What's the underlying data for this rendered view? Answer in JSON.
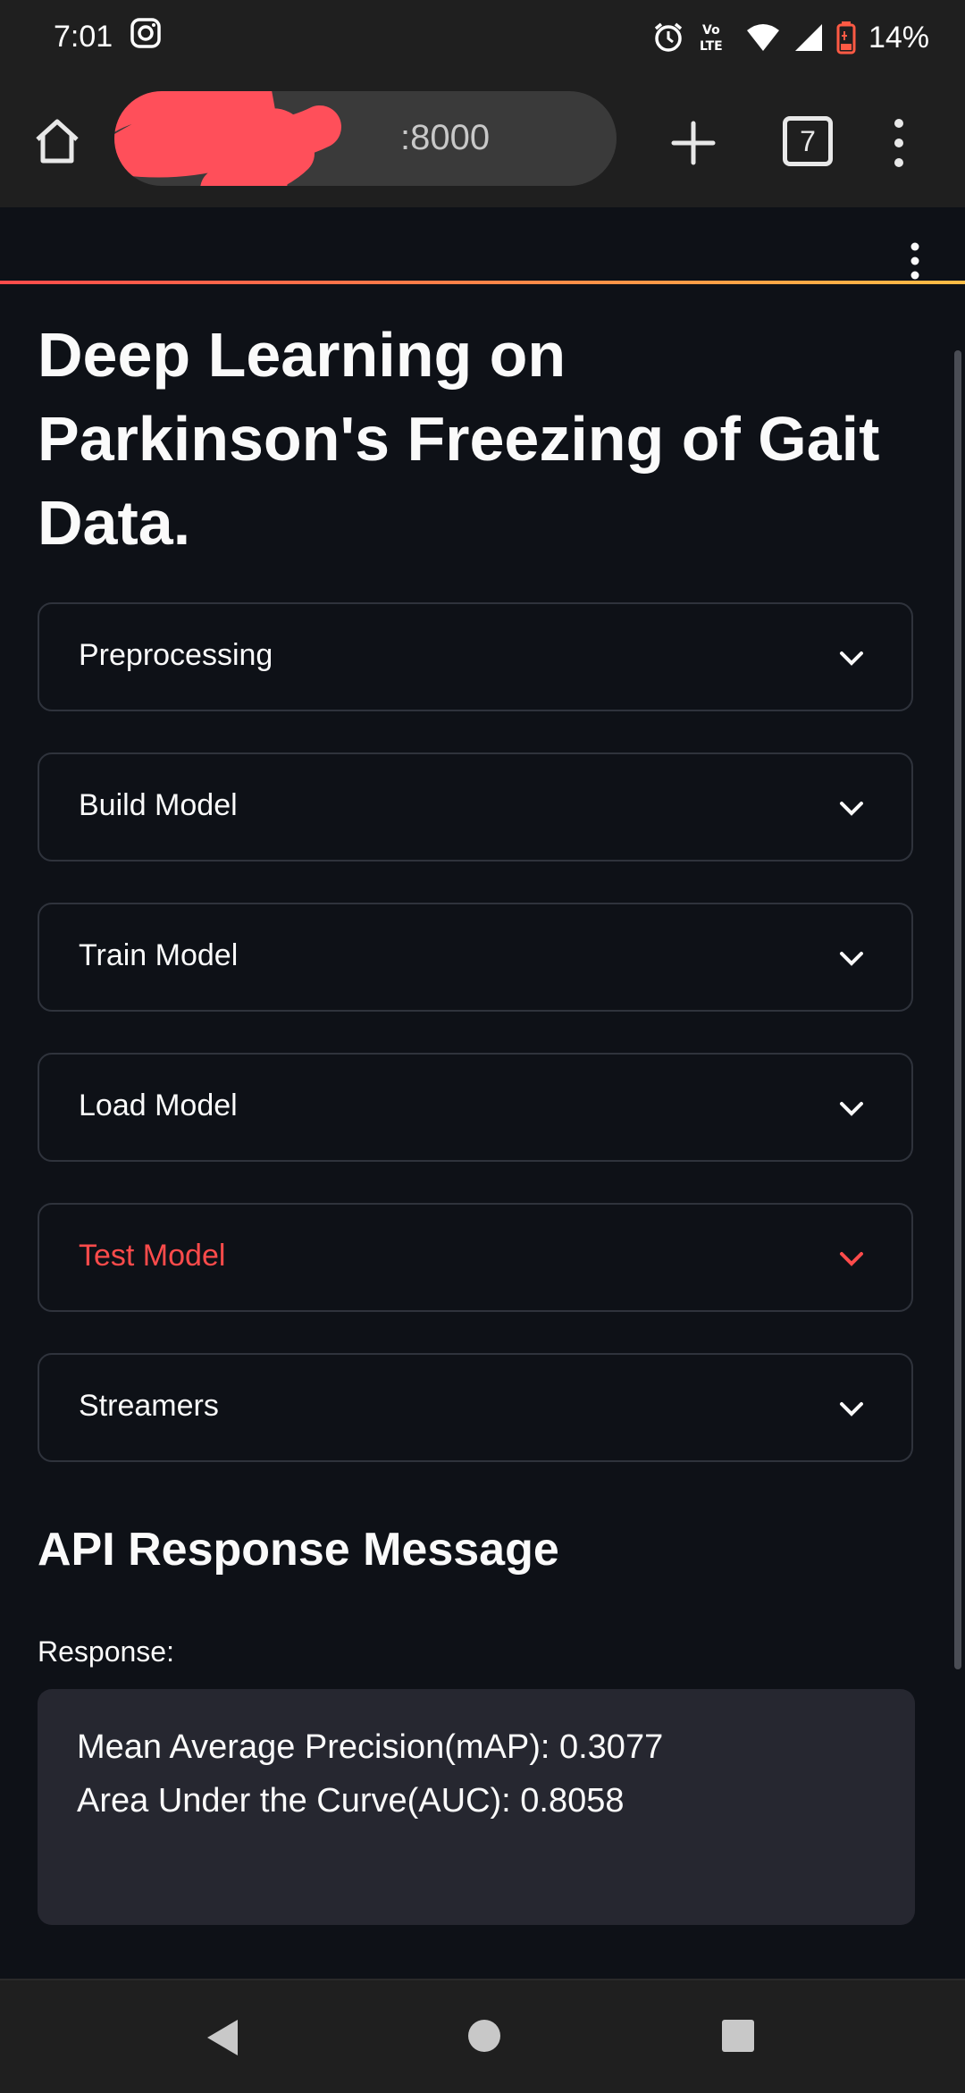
{
  "status_bar": {
    "time": "7:01",
    "battery": "14%",
    "network_badge": "Vo LTE"
  },
  "browser": {
    "url_visible": ":8000",
    "tab_count": "7"
  },
  "app": {
    "title": "Deep Learning on Parkinson's Freezing of Gait Data.",
    "expanders": [
      {
        "label": "Preprocessing",
        "active": false
      },
      {
        "label": "Build Model",
        "active": false
      },
      {
        "label": "Train Model",
        "active": false
      },
      {
        "label": "Load Model",
        "active": false
      },
      {
        "label": "Test Model",
        "active": true
      },
      {
        "label": "Streamers",
        "active": false
      }
    ],
    "section_heading": "API Response Message",
    "response_label": "Response:",
    "response_lines": [
      "Mean Average Precision(mAP): 0.3077",
      "Area Under the Curve(AUC): 0.8058"
    ]
  },
  "colors": {
    "background": "#0e1117",
    "accent": "#ff4b4b",
    "panel": "#262730",
    "border": "#2f333c"
  }
}
